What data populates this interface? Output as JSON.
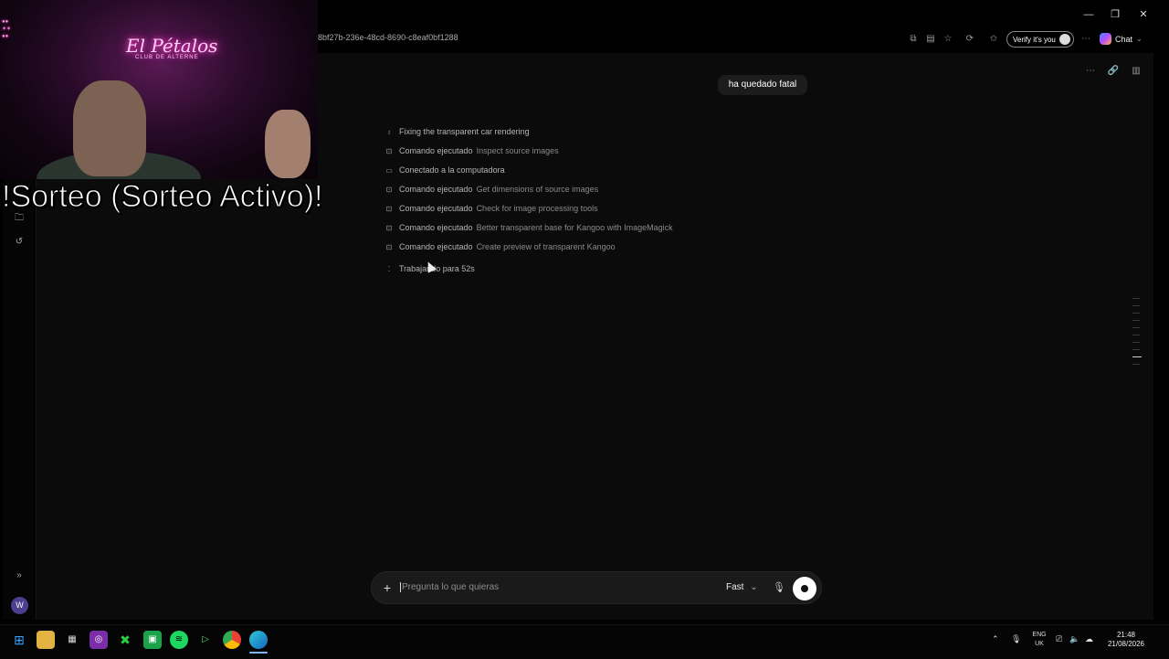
{
  "browser": {
    "url": "8bf27b-236e-48cd-8690-c8eaf0bf1288",
    "verify_label": "Verify it's you",
    "chat_label": "Chat",
    "window_controls": [
      "minimize-icon",
      "restore-icon",
      "close-icon"
    ]
  },
  "chat": {
    "user_message": "ha quedado fatal",
    "steps": [
      {
        "icon": "lightbulb-icon",
        "label": "Fixing the transparent car rendering",
        "detail": ""
      },
      {
        "icon": "terminal-icon",
        "label": "Comando ejecutado",
        "detail": "Inspect source images"
      },
      {
        "icon": "computer-icon",
        "label": "Conectado a la computadora",
        "detail": ""
      },
      {
        "icon": "terminal-icon",
        "label": "Comando ejecutado",
        "detail": "Get dimensions of source images"
      },
      {
        "icon": "terminal-icon",
        "label": "Comando ejecutado",
        "detail": "Check for image processing tools"
      },
      {
        "icon": "terminal-icon",
        "label": "Comando ejecutado",
        "detail": "Better transparent base for Kangoo with ImageMagick"
      },
      {
        "icon": "terminal-icon",
        "label": "Comando ejecutado",
        "detail": "Create preview of transparent Kangoo"
      },
      {
        "icon": "loading-icon",
        "label": "Trabajando para 52s",
        "detail": ""
      }
    ],
    "composer": {
      "placeholder": "Pregunta lo que quieras",
      "mode": "Fast"
    }
  },
  "sidebar": {
    "avatar_letter": "W"
  },
  "stream_overlay": {
    "logo_text": "El Pétalos",
    "logo_sub": "CLUB DE ALTERNE",
    "caption": "!Sorteo (Sorteo Activo)!"
  },
  "taskbar": {
    "apps": [
      "windows-icon",
      "file-explorer-icon",
      "store-icon",
      "app-icon",
      "xbox-icon",
      "app-green-icon",
      "spotify-icon",
      "play-icon",
      "chrome-icon",
      "edge-icon"
    ],
    "lang_top": "ENG",
    "lang_bottom": "UK",
    "time": "21:48",
    "date": "21/08/2026"
  },
  "colors": {
    "accent": "#ffffff",
    "background": "#0b0b0b",
    "neon": "#ff3cc8"
  }
}
